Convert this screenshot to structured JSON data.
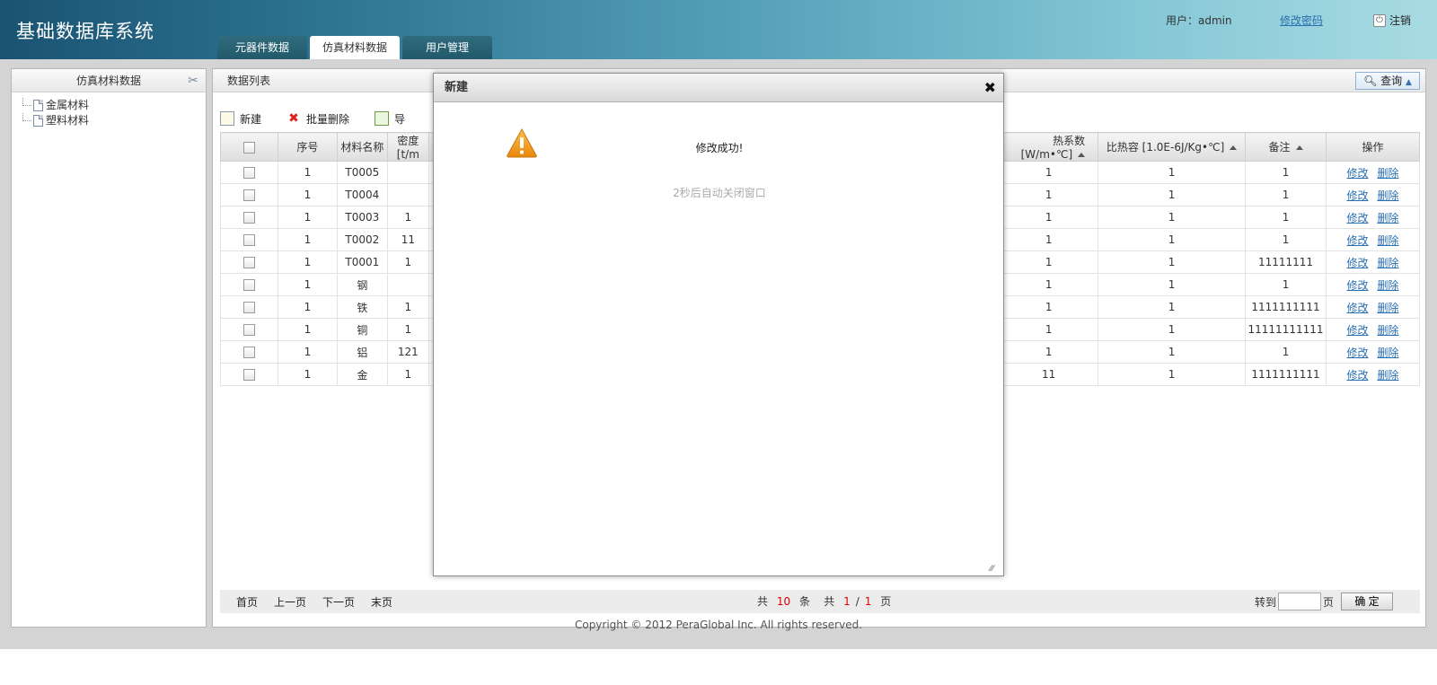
{
  "header": {
    "app_title": "基础数据库系统",
    "tabs": [
      {
        "label": "元器件数据",
        "active": false
      },
      {
        "label": "仿真材料数据",
        "active": true
      },
      {
        "label": "用户管理",
        "active": false
      }
    ],
    "user_label": "用户：admin",
    "change_password": "修改密码",
    "logout": "注销"
  },
  "sidebar": {
    "title": "仿真材料数据",
    "tree": [
      {
        "label": "金属材料"
      },
      {
        "label": "塑料材料"
      }
    ]
  },
  "main": {
    "title": "数据列表",
    "query_button": "查询",
    "toolbar": {
      "new": "新建",
      "batch_delete": "批量删除",
      "export": "导"
    },
    "columns": [
      "序号",
      "材料名称",
      "密度[t/m",
      "热系数 [W/m•℃]",
      "比热容 [1.0E-6J/Kg•℃]",
      "备注",
      "操作"
    ],
    "rows": [
      {
        "seq": "1",
        "name": "T0005",
        "density": "",
        "thermal": "1",
        "specific": "1",
        "note": "1"
      },
      {
        "seq": "1",
        "name": "T0004",
        "density": "",
        "thermal": "1",
        "specific": "1",
        "note": "1"
      },
      {
        "seq": "1",
        "name": "T0003",
        "density": "1",
        "thermal": "1",
        "specific": "1",
        "note": "1"
      },
      {
        "seq": "1",
        "name": "T0002",
        "density": "11",
        "thermal": "1",
        "specific": "1",
        "note": "1"
      },
      {
        "seq": "1",
        "name": "T0001",
        "density": "1",
        "thermal": "1",
        "specific": "1",
        "note": "11111111"
      },
      {
        "seq": "1",
        "name": "钢",
        "density": "",
        "thermal": "1",
        "specific": "1",
        "note": "1"
      },
      {
        "seq": "1",
        "name": "铁",
        "density": "1",
        "thermal": "1",
        "specific": "1",
        "note": "1111111111"
      },
      {
        "seq": "1",
        "name": "铜",
        "density": "1",
        "thermal": "1",
        "specific": "1",
        "note": "11111111111"
      },
      {
        "seq": "1",
        "name": "铝",
        "density": "121",
        "thermal": "1",
        "specific": "1",
        "note": "1"
      },
      {
        "seq": "1",
        "name": "金",
        "density": "1",
        "thermal": "11",
        "specific": "1",
        "note": "1111111111"
      }
    ],
    "row_actions": {
      "edit": "修改",
      "delete": "删除"
    },
    "pager": {
      "first": "首页",
      "prev": "上一页",
      "next": "下一页",
      "last": "末页",
      "total_prefix": "共",
      "total": "10",
      "total_suffix": "条",
      "pages_prefix": "共",
      "current_page": "1",
      "sep": "/",
      "page_count": "1",
      "pages_suffix": "页",
      "goto_label": "转到",
      "goto_suffix": "页",
      "goto_value": "",
      "confirm": "确 定"
    }
  },
  "modal": {
    "title": "新建",
    "message": "修改成功!",
    "sub_message": "2秒后自动关闭窗口",
    "close": "✖"
  },
  "footer": {
    "copyright": "Copyright © 2012 PeraGlobal Inc. All rights reserved."
  },
  "colors": {
    "header_dark": "#1a5372",
    "header_light": "#a9dbe3",
    "link": "#2a6fb2",
    "highlight_red": "#dd0000",
    "warning_orange": "#f0a020"
  }
}
